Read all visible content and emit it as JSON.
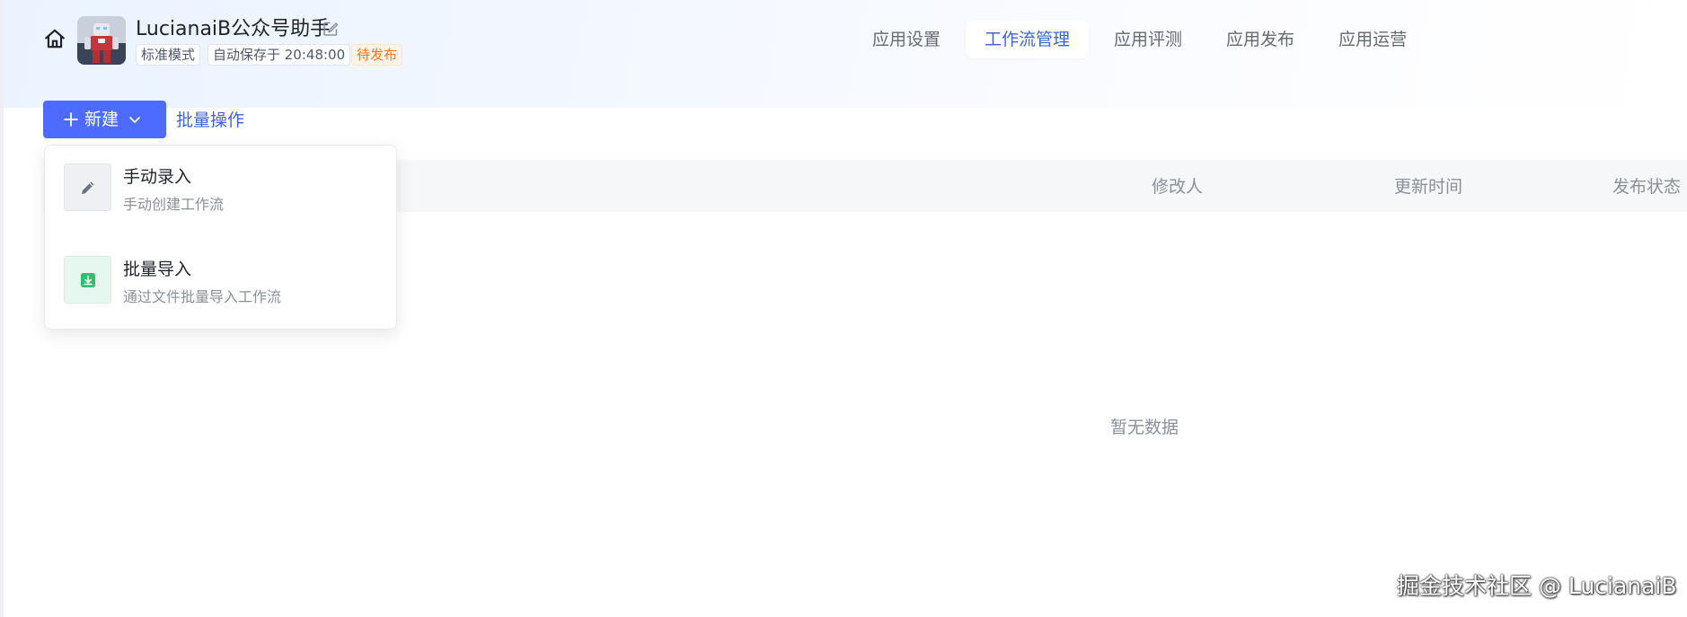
{
  "header": {
    "app_title": "LucianaiB公众号助手",
    "mode_tag": "标准模式",
    "autosave_tag": "自动保存于 20:48:00",
    "status_tag": "待发布",
    "icons": {
      "home": "home-icon",
      "edit": "edit-icon",
      "avatar": "robot-avatar"
    }
  },
  "tabs": [
    {
      "label": "应用设置"
    },
    {
      "label": "工作流管理",
      "active": true
    },
    {
      "label": "应用评测"
    },
    {
      "label": "应用发布"
    },
    {
      "label": "应用运营"
    }
  ],
  "toolbar": {
    "new_label": "新建",
    "bulk_label": "批量操作"
  },
  "dropdown": {
    "items": [
      {
        "title": "手动录入",
        "desc": "手动创建工作流",
        "icon": "pencil-icon"
      },
      {
        "title": "批量导入",
        "desc": "通过文件批量导入工作流",
        "icon": "download-icon"
      }
    ]
  },
  "table": {
    "columns": [
      "修改人",
      "更新时间",
      "发布状态"
    ],
    "empty_text": "暂无数据"
  },
  "watermark": "掘金技术社区 @ LucianaiB",
  "colors": {
    "primary": "#4d6bfe",
    "active_tab_text": "#3c64dc",
    "status_orange": "#f2751f",
    "import_green": "#2fbf71"
  }
}
